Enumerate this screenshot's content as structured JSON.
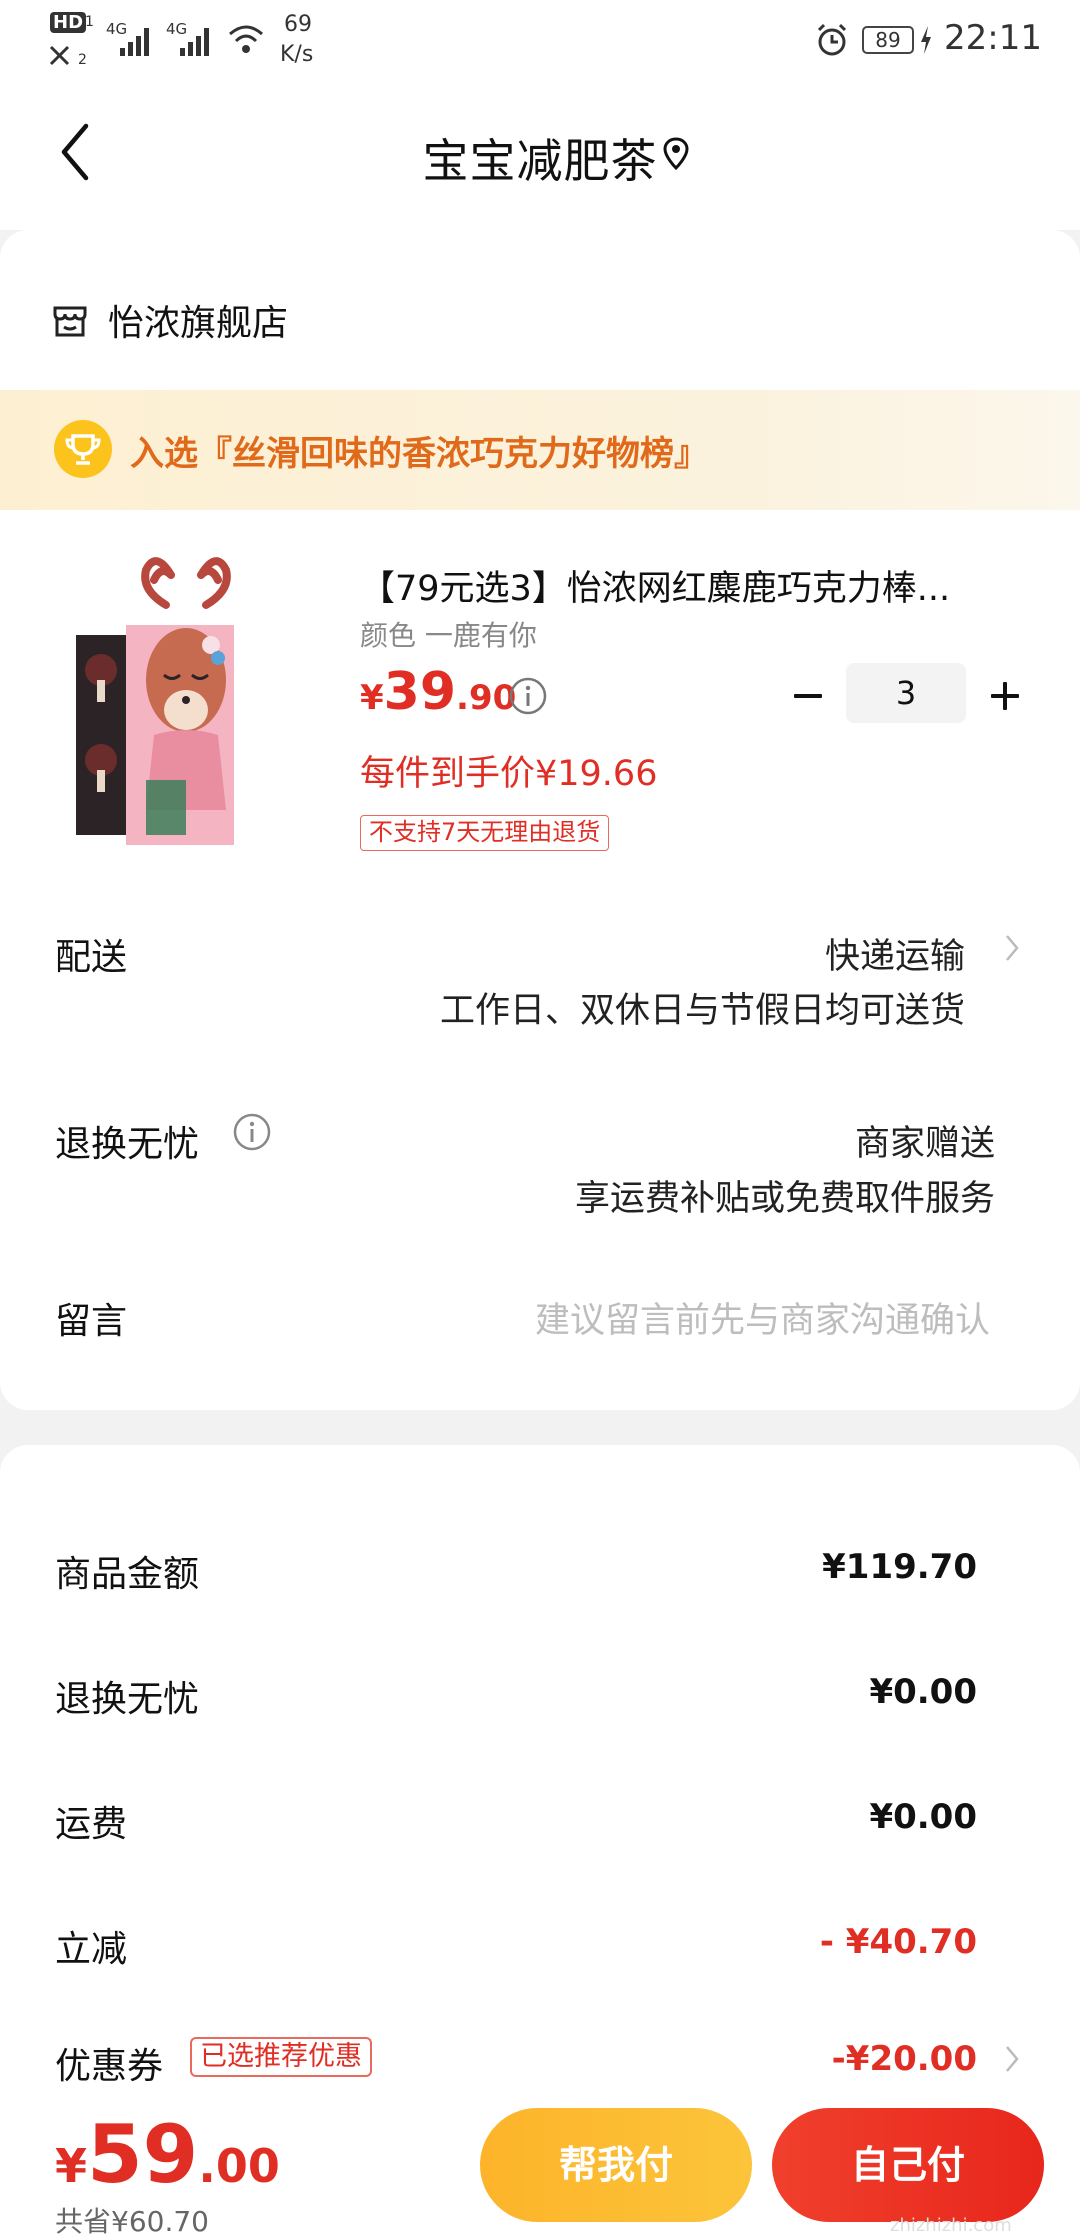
{
  "status_bar": {
    "hd": "HD",
    "sim1": "1",
    "sim2": "2",
    "net1": "4G",
    "net2": "4G",
    "speed_value": "69",
    "speed_unit": "K/s",
    "battery": "89",
    "time": "22:11"
  },
  "header": {
    "title": "宝宝减肥茶"
  },
  "shop": {
    "name": "怡浓旗舰店"
  },
  "banner": {
    "text": "入选『丝滑回味的香浓巧克力好物榜』"
  },
  "product": {
    "title": "【79元选3】怡浓网红麋鹿巧克力棒...",
    "variant": "颜色 一鹿有你",
    "price_symbol": "¥",
    "price_int": "39",
    "price_dec": ".90",
    "unit_price": "每件到手价¥19.66",
    "tag": "不支持7天无理由退货",
    "quantity": "3"
  },
  "delivery": {
    "label": "配送",
    "method": "快递运输",
    "note": "工作日、双休日与节假日均可送货"
  },
  "return_service": {
    "label": "退换无忧",
    "value": "商家赠送",
    "note": "享运费补贴或免费取件服务"
  },
  "remark": {
    "label": "留言",
    "placeholder": "建议留言前先与商家沟通确认"
  },
  "summary": {
    "goods_label": "商品金额",
    "goods_value": "¥119.70",
    "return_label": "退换无忧",
    "return_value": "¥0.00",
    "shipping_label": "运费",
    "shipping_value": "¥0.00",
    "discount_label": "立减",
    "discount_value": "- ¥40.70",
    "coupon_label": "优惠券",
    "coupon_tag": "已选推荐优惠",
    "coupon_value": "-¥20.00"
  },
  "bottom": {
    "total_symbol": "¥",
    "total_int": "59",
    "total_dec": ".00",
    "saved": "共省¥60.70",
    "help_pay": "帮我付",
    "self_pay": "自己付"
  },
  "watermark": "zhizhizhi.com",
  "colors": {
    "accent_red": "#e02e24",
    "banner_orange": "#e06a1a",
    "help_pay_yellow": "#fdb42a"
  }
}
